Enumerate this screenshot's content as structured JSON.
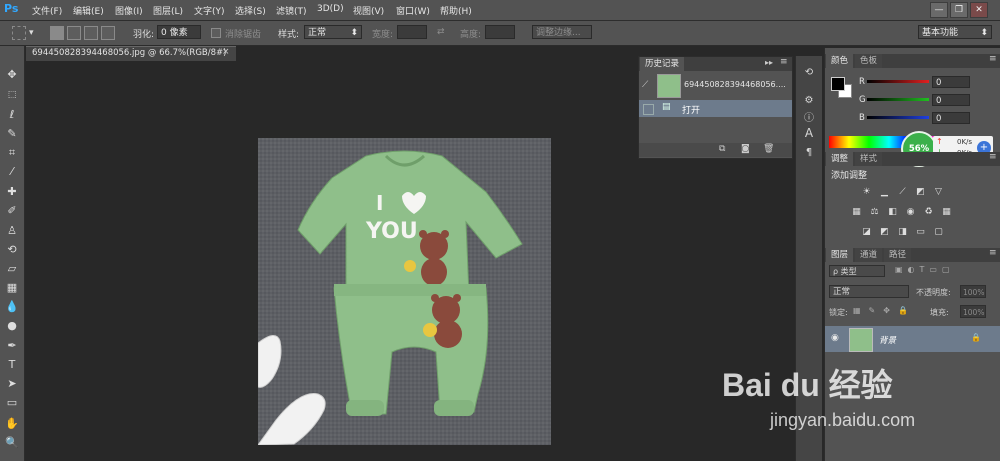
{
  "app": {
    "logo": "Ps",
    "workspace": "基本功能"
  },
  "menu": [
    "文件(F)",
    "编辑(E)",
    "图像(I)",
    "图层(L)",
    "文字(Y)",
    "选择(S)",
    "滤镜(T)",
    "3D(D)",
    "视图(V)",
    "窗口(W)",
    "帮助(H)"
  ],
  "window_buttons": [
    "—",
    "❐",
    "✕"
  ],
  "options": {
    "feather_label": "羽化:",
    "feather_value": "0 像素",
    "antialias_label": "消除锯齿",
    "style_label": "样式:",
    "style_value": "正常",
    "width_label": "宽度:",
    "height_label": "高度:",
    "refine_edge": "调整边缘..."
  },
  "document": {
    "tab_label": "6944508283944680​56.jpg @ 66.7%(RGB/8#)",
    "close": "×"
  },
  "history_panel": {
    "title": "历史记录",
    "snapshot_name": "694450828394468056....",
    "states": [
      {
        "label": "打开"
      }
    ]
  },
  "color_panel": {
    "tabs": [
      "颜色",
      "色板"
    ],
    "channels": [
      {
        "label": "R",
        "value": "0",
        "color": "#e02020"
      },
      {
        "label": "G",
        "value": "0",
        "color": "#20c020"
      },
      {
        "label": "B",
        "value": "0",
        "color": "#2040e0"
      }
    ]
  },
  "network_widget": {
    "percent": "56%",
    "up": "0K/s",
    "down": "0K/s"
  },
  "adjust_panel": {
    "tabs": [
      "调整",
      "样式"
    ],
    "title": "添加调整"
  },
  "layers_panel": {
    "tabs": [
      "图层",
      "通道",
      "路径"
    ],
    "filter_label": "ρ 类型",
    "blend_mode": "正常",
    "opacity_label": "不透明度:",
    "opacity_value": "100%",
    "lock_label": "锁定:",
    "fill_label": "填充:",
    "fill_value": "100%",
    "layers": [
      {
        "name": "背景"
      }
    ]
  },
  "watermark": {
    "brand": "Bai du 经验",
    "url": "jingyan.baidu.com"
  },
  "colors": {
    "ui_bg": "#535353",
    "canvas_bg": "#282828",
    "garment": "#8fbf8a",
    "carpet": "#5c5e63",
    "accent_blue": "#31a8ff"
  }
}
